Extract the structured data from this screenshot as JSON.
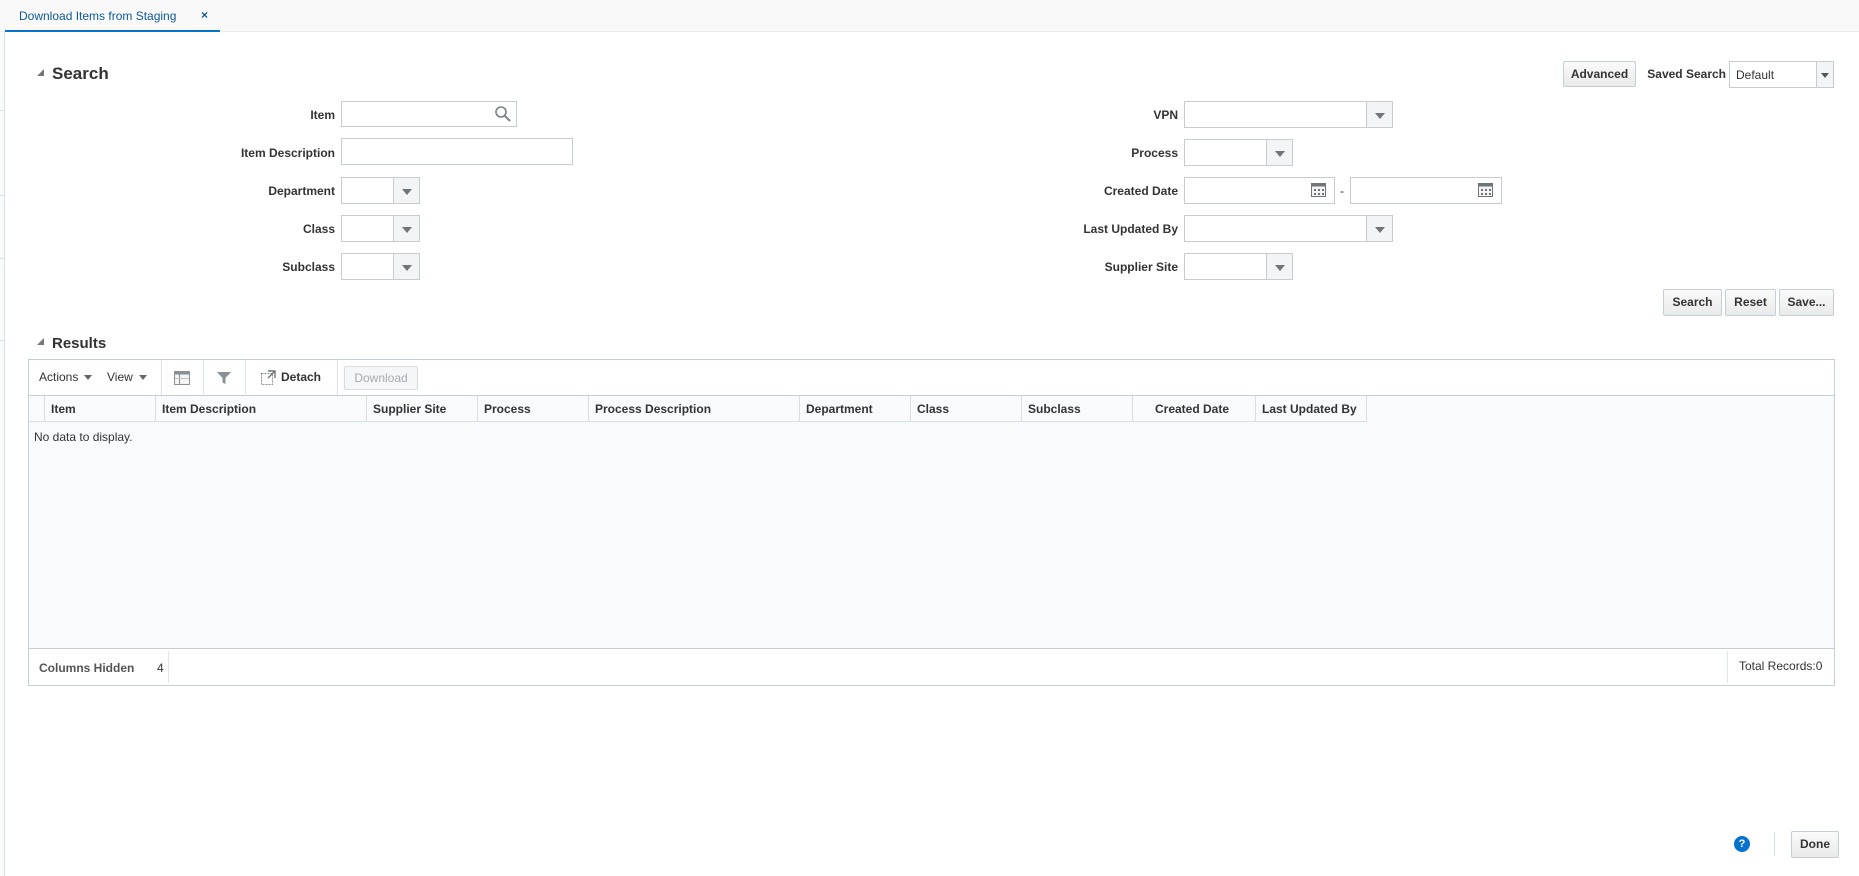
{
  "tab": {
    "title": "Download Items from Staging",
    "close": "×"
  },
  "search": {
    "title": "Search",
    "advanced_label": "Advanced",
    "saved_search_label": "Saved Search",
    "saved_search_value": "Default",
    "labels": {
      "item": "Item",
      "item_description": "Item Description",
      "department": "Department",
      "class": "Class",
      "subclass": "Subclass",
      "vpn": "VPN",
      "process": "Process",
      "created_date": "Created Date",
      "date_separator": "-",
      "last_updated_by": "Last Updated By",
      "supplier_site": "Supplier Site"
    },
    "values": {
      "item": "",
      "item_description": "",
      "department": "",
      "class": "",
      "subclass": "",
      "vpn": "",
      "process": "",
      "created_date_from": "",
      "created_date_to": "",
      "last_updated_by": "",
      "supplier_site": ""
    },
    "buttons": {
      "search": "Search",
      "reset": "Reset",
      "save": "Save..."
    }
  },
  "results": {
    "title": "Results",
    "toolbar": {
      "actions": "Actions",
      "view": "View",
      "detach": "Detach",
      "download": "Download"
    },
    "columns": [
      "Item",
      "Item Description",
      "Supplier Site",
      "Process",
      "Process Description",
      "Department",
      "Class",
      "Subclass",
      "Created Date",
      "Last Updated By"
    ],
    "empty_message": "No data to display.",
    "footer": {
      "columns_hidden_label": "Columns Hidden",
      "columns_hidden_count": "4",
      "total_records": "Total Records:0"
    }
  },
  "bottom": {
    "help": "?",
    "done_label": "Done"
  },
  "icons": {
    "search": "search-icon",
    "calendar": "calendar-icon",
    "freeze": "freeze-column-icon",
    "filter": "filter-icon",
    "detach": "detach-icon",
    "help": "help-icon",
    "dropdown": "chevron-down-icon"
  },
  "colors": {
    "accent": "#0572ce",
    "tab_text": "#0f5a96",
    "border": "#c4ced7",
    "grid_bg": "#f8fafc"
  }
}
